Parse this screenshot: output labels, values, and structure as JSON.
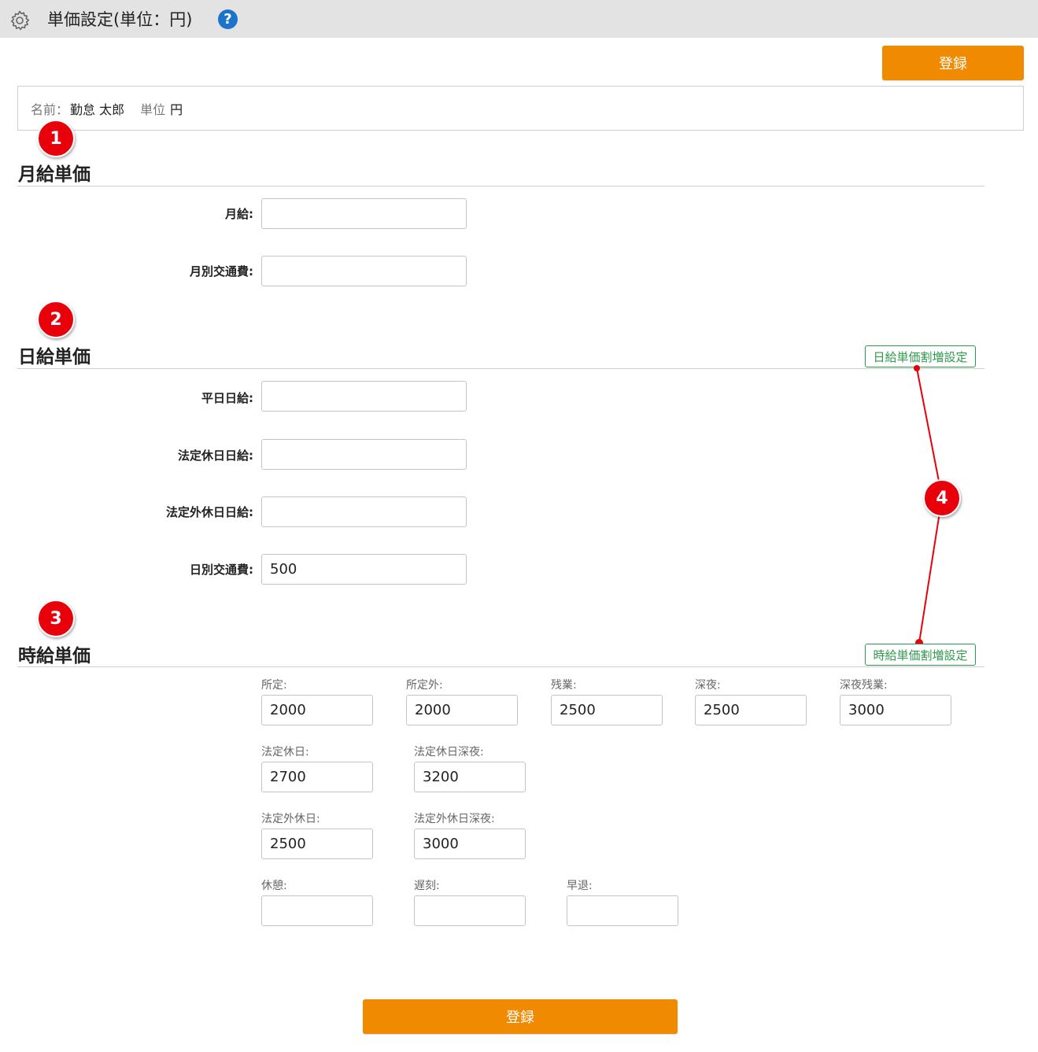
{
  "header": {
    "icon": "gear-icon",
    "title": "単価設定(単位：円)",
    "help": "?"
  },
  "actions": {
    "register_label": "登録"
  },
  "info": {
    "name_label": "名前：",
    "name_value": "勤怠 太郎",
    "unit_label": "単位",
    "unit_value": "円"
  },
  "markers": [
    "1",
    "2",
    "3",
    "4"
  ],
  "colors": {
    "accent": "#f08a00",
    "marker": "#e8000b",
    "link": "#2e9a4c",
    "help": "#1b74c9"
  },
  "monthly": {
    "title": "月給単価",
    "fields": [
      {
        "label": "月給:",
        "value": ""
      },
      {
        "label": "月別交通費:",
        "value": ""
      }
    ]
  },
  "daily": {
    "title": "日給単価",
    "premium_link": "日給単価割増設定",
    "fields": [
      {
        "label": "平日日給:",
        "value": ""
      },
      {
        "label": "法定休日日給:",
        "value": ""
      },
      {
        "label": "法定外休日日給:",
        "value": ""
      },
      {
        "label": "日別交通費:",
        "value": "500"
      }
    ]
  },
  "hourly": {
    "title": "時給単価",
    "premium_link": "時給単価割増設定",
    "rows": [
      [
        {
          "label": "所定:",
          "value": "2000"
        },
        {
          "label": "所定外:",
          "value": "2000"
        },
        {
          "label": "残業:",
          "value": "2500"
        },
        {
          "label": "深夜:",
          "value": "2500"
        },
        {
          "label": "深夜残業:",
          "value": "3000"
        }
      ],
      [
        {
          "label": "法定休日:",
          "value": "2700"
        },
        {
          "label": "法定休日深夜:",
          "value": "3200"
        }
      ],
      [
        {
          "label": "法定外休日:",
          "value": "2500"
        },
        {
          "label": "法定外休日深夜:",
          "value": "3000"
        }
      ],
      [
        {
          "label": "休憩:",
          "value": ""
        },
        {
          "label": "遅刻:",
          "value": ""
        },
        {
          "label": "早退:",
          "value": ""
        }
      ]
    ]
  }
}
